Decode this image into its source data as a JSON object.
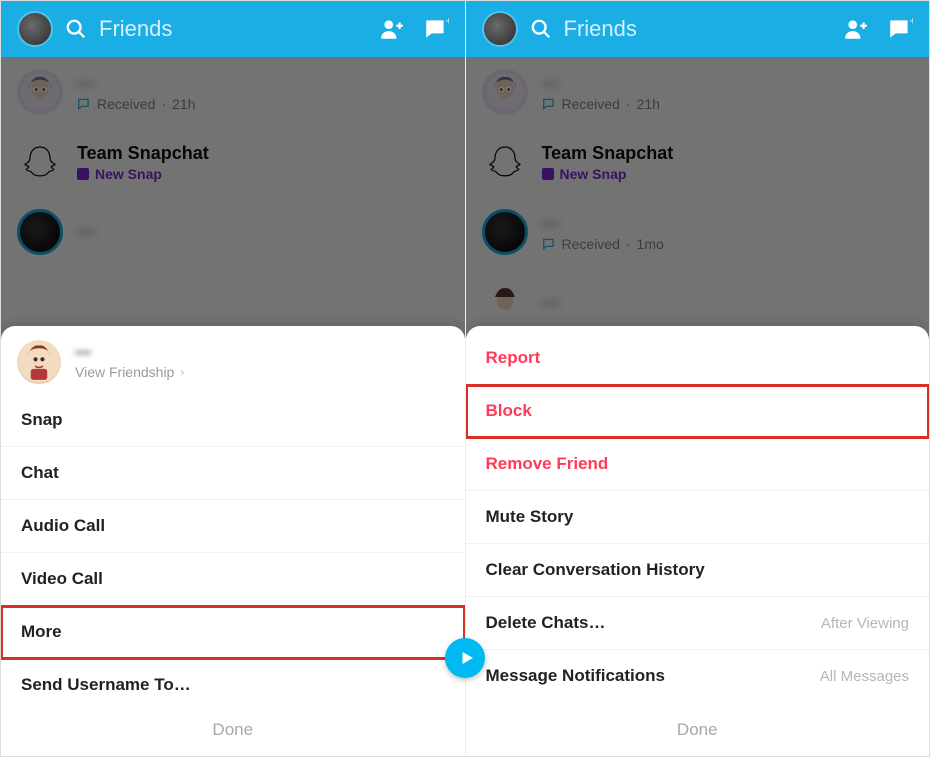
{
  "header": {
    "title": "Friends"
  },
  "friends": [
    {
      "name": "—",
      "status_prefix": "Received",
      "status_time": "21h",
      "avatar": "bitmoji-purple"
    },
    {
      "name": "Team Snapchat",
      "status_prefix": "New Snap",
      "status_time": "",
      "avatar": "ghost"
    },
    {
      "name": "—",
      "status_prefix": "Received",
      "status_time": "1mo",
      "avatar": "story"
    },
    {
      "name": "—",
      "status_prefix": "",
      "status_time": "",
      "avatar": "bitmoji-plain"
    }
  ],
  "sheet_left": {
    "user_name": "—",
    "view_friendship": "View Friendship",
    "options": [
      {
        "label": "Snap"
      },
      {
        "label": "Chat"
      },
      {
        "label": "Audio Call"
      },
      {
        "label": "Video Call"
      },
      {
        "label": "More",
        "highlight": true
      },
      {
        "label": "Send Username To…"
      }
    ],
    "done": "Done"
  },
  "sheet_right": {
    "options": [
      {
        "label": "Report",
        "danger": true
      },
      {
        "label": "Block",
        "danger": true,
        "highlight": true
      },
      {
        "label": "Remove Friend",
        "danger": true
      },
      {
        "label": "Mute Story"
      },
      {
        "label": "Clear Conversation History"
      },
      {
        "label": "Delete Chats…",
        "trailing": "After Viewing"
      },
      {
        "label": "Message Notifications",
        "trailing": "All Messages"
      }
    ],
    "done": "Done"
  }
}
